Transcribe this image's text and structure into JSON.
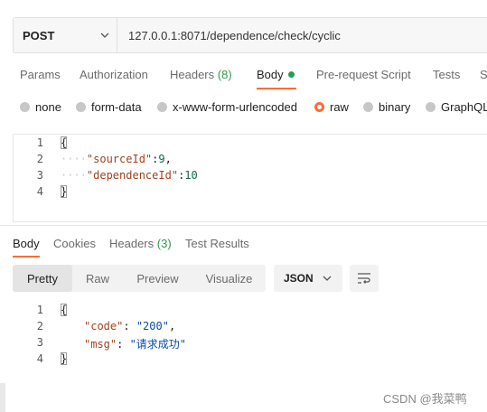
{
  "request": {
    "method": "POST",
    "url": "127.0.0.1:8071/dependence/check/cyclic"
  },
  "request_tabs": [
    {
      "label": "Params"
    },
    {
      "label": "Authorization"
    },
    {
      "label": "Headers",
      "count": "(8)"
    },
    {
      "label": "Body"
    },
    {
      "label": "Pre-request Script"
    },
    {
      "label": "Tests"
    },
    {
      "label": "S"
    }
  ],
  "body_types": [
    {
      "label": "none",
      "selected": false
    },
    {
      "label": "form-data",
      "selected": false
    },
    {
      "label": "x-www-form-urlencoded",
      "selected": false
    },
    {
      "label": "raw",
      "selected": true
    },
    {
      "label": "binary",
      "selected": false
    },
    {
      "label": "GraphQL",
      "selected": false
    }
  ],
  "request_body": {
    "line_numbers": [
      "1",
      "2",
      "3",
      "4"
    ],
    "open": "{",
    "close": "}",
    "fields": [
      {
        "key": "\"sourceId\"",
        "sep": ":",
        "value": "9",
        "trail": ","
      },
      {
        "key": "\"dependenceId\"",
        "sep": ":",
        "value": "10",
        "trail": ""
      }
    ]
  },
  "response_tabs": [
    {
      "label": "Body"
    },
    {
      "label": "Cookies"
    },
    {
      "label": "Headers",
      "count": "(3)"
    },
    {
      "label": "Test Results"
    }
  ],
  "view_modes": [
    "Pretty",
    "Raw",
    "Preview",
    "Visualize"
  ],
  "format": "JSON",
  "response_body": {
    "line_numbers": [
      "1",
      "2",
      "3",
      "4"
    ],
    "open": "{",
    "close": "}",
    "fields": [
      {
        "key": "\"code\"",
        "sep": ": ",
        "value": "\"200\"",
        "trail": ","
      },
      {
        "key": "\"msg\"",
        "sep": ": ",
        "value": "\"请求成功\"",
        "trail": ""
      }
    ]
  },
  "watermark": "CSDN @我菜鸭",
  "colors": {
    "accent": "#ff6c37",
    "active_dot": "#18a54d",
    "count": "#2d9a4c"
  }
}
